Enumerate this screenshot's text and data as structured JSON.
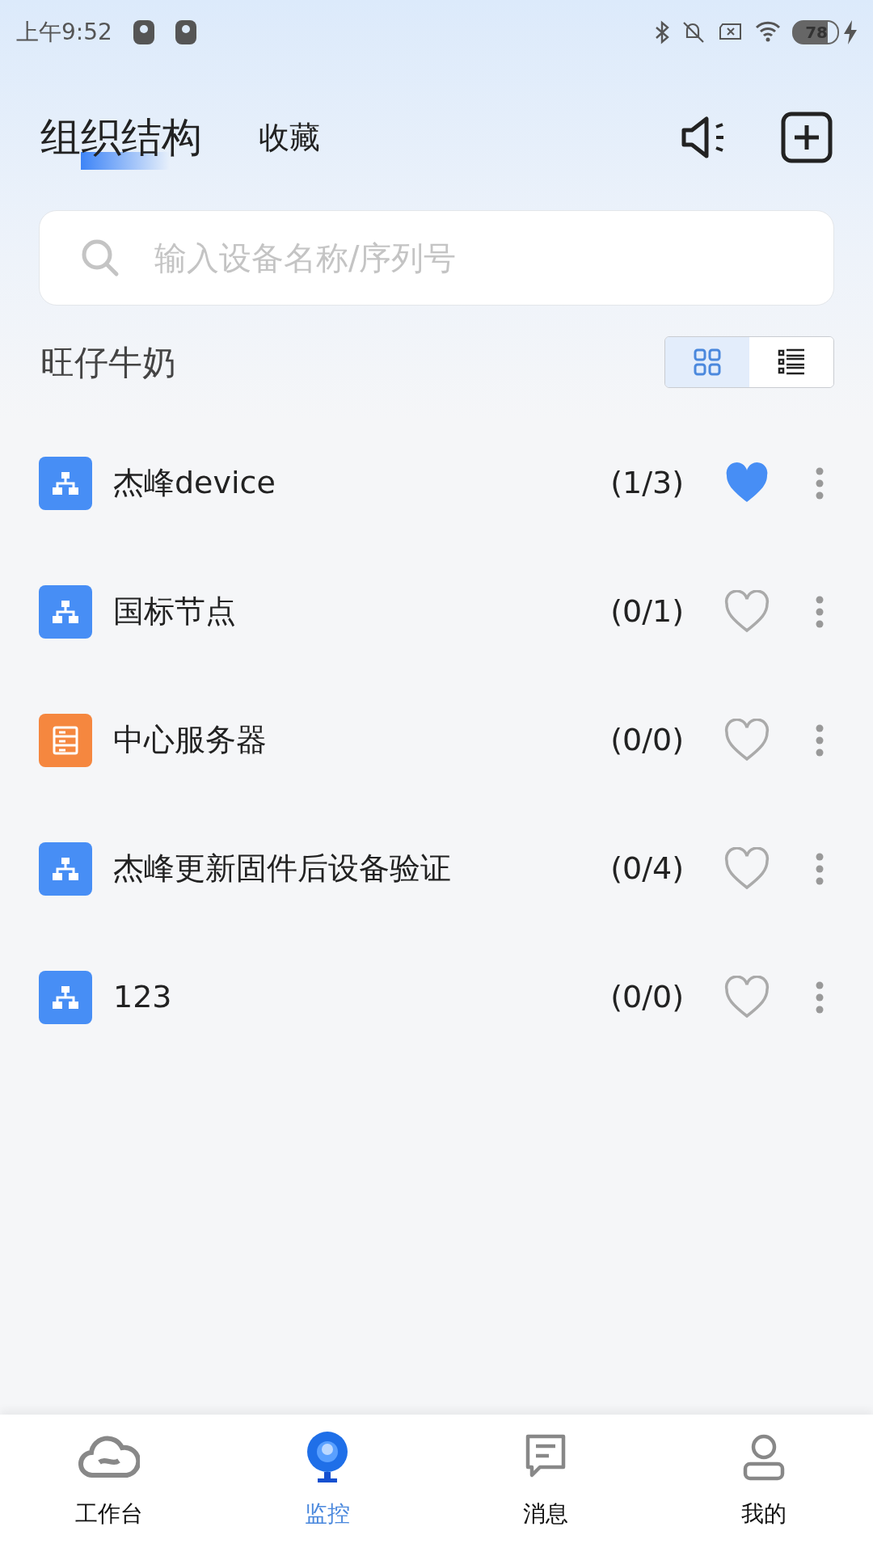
{
  "status_bar": {
    "time": "上午9:52",
    "battery": "78"
  },
  "tabs": [
    {
      "label": "组织结构",
      "selected": true
    },
    {
      "label": "收藏",
      "selected": false
    }
  ],
  "search": {
    "placeholder": "输入设备名称/序列号"
  },
  "section_title": "旺仔牛奶",
  "view_modes": [
    {
      "kind": "grid",
      "selected": true
    },
    {
      "kind": "list",
      "selected": false
    }
  ],
  "items": [
    {
      "kind": "org",
      "name": "杰峰device",
      "count": "(1/3)",
      "favorite": true
    },
    {
      "kind": "org",
      "name": "国标节点",
      "count": "(0/1)",
      "favorite": false
    },
    {
      "kind": "server",
      "name": "中心服务器",
      "count": "(0/0)",
      "favorite": false
    },
    {
      "kind": "org",
      "name": "杰峰更新固件后设备验证",
      "count": "(0/4)",
      "favorite": false
    },
    {
      "kind": "org",
      "name": "123",
      "count": "(0/0)",
      "favorite": false
    }
  ],
  "nav": [
    {
      "kind": "workbench",
      "label": "工作台",
      "selected": false
    },
    {
      "kind": "monitor",
      "label": "监控",
      "selected": true
    },
    {
      "kind": "messages",
      "label": "消息",
      "selected": false
    },
    {
      "kind": "profile",
      "label": "我的",
      "selected": false
    }
  ]
}
